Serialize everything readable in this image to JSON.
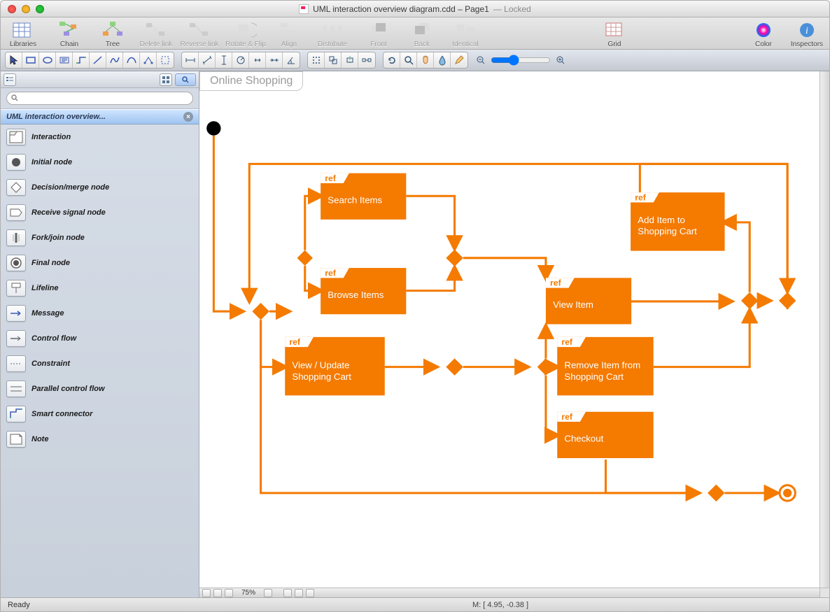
{
  "window": {
    "title": "UML interaction overview diagram.cdd – Page1",
    "locked": "Locked"
  },
  "toolbar": {
    "libraries": "Libraries",
    "chain": "Chain",
    "tree": "Tree",
    "delete_link": "Delete link",
    "reverse_link": "Reverse link",
    "rotate_flip": "Rotate & Flip",
    "align": "Align",
    "distribute": "Distribute",
    "front": "Front",
    "back": "Back",
    "identical": "Identical",
    "grid": "Grid",
    "color": "Color",
    "inspectors": "Inspectors"
  },
  "sidebar": {
    "library_title": "UML interaction overview...",
    "search_placeholder": "",
    "items": [
      {
        "label": "Interaction"
      },
      {
        "label": "Initial node"
      },
      {
        "label": "Decision/merge node"
      },
      {
        "label": "Receive signal node"
      },
      {
        "label": "Fork/join node"
      },
      {
        "label": "Final node"
      },
      {
        "label": "Lifeline"
      },
      {
        "label": "Message"
      },
      {
        "label": "Control flow"
      },
      {
        "label": "Constraint"
      },
      {
        "label": "Parallel control flow"
      },
      {
        "label": "Smart connector"
      },
      {
        "label": "Note"
      }
    ]
  },
  "canvas": {
    "frame_title": "Online Shopping",
    "zoom": "75%",
    "nodes": {
      "search_items": {
        "ref": "ref",
        "label": "Search Items"
      },
      "browse_items": {
        "ref": "ref",
        "label": "Browse Items"
      },
      "view_update_cart": {
        "ref": "ref",
        "label": "View / Update Shopping Cart"
      },
      "view_item": {
        "ref": "ref",
        "label": "View Item"
      },
      "add_item": {
        "ref": "ref",
        "label": "Add Item to Shopping Cart"
      },
      "remove_item": {
        "ref": "ref",
        "label": "Remove Item from Shopping Cart"
      },
      "checkout": {
        "ref": "ref",
        "label": "Checkout"
      }
    }
  },
  "statusbar": {
    "ready": "Ready",
    "coords": "M: [ 4.95, -0.38 ]"
  }
}
